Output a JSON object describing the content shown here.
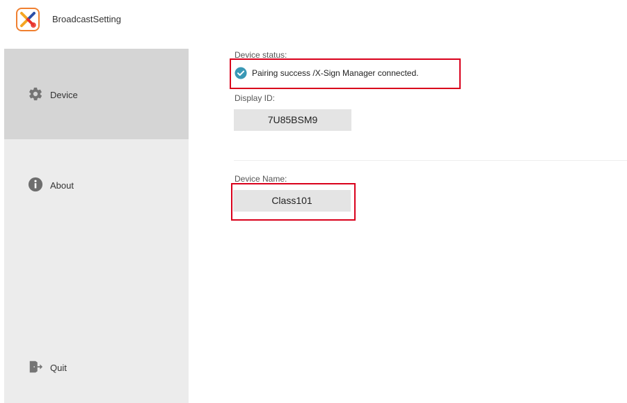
{
  "app": {
    "title": "BroadcastSetting",
    "icon": "x-sign-app-icon"
  },
  "sidebar": {
    "items": [
      {
        "label": "Device",
        "icon": "gear-icon",
        "active": true
      },
      {
        "label": "About",
        "icon": "info-icon",
        "active": false
      }
    ],
    "quit": {
      "label": "Quit",
      "icon": "exit-door-icon"
    }
  },
  "device": {
    "status_label": "Device status:",
    "status_text": "Pairing success /X-Sign Manager connected.",
    "status_icon": "check-circle-icon",
    "display_id_label": "Display ID:",
    "display_id": "7U85BSM9",
    "device_name_label": "Device Name:",
    "device_name": "Class101"
  },
  "colors": {
    "accent_teal": "#3a98b5",
    "highlight_red": "#d9001b",
    "sidebar_bg": "#ececec",
    "sidebar_active": "#d5d5d5",
    "field_bg": "#e4e4e4"
  }
}
